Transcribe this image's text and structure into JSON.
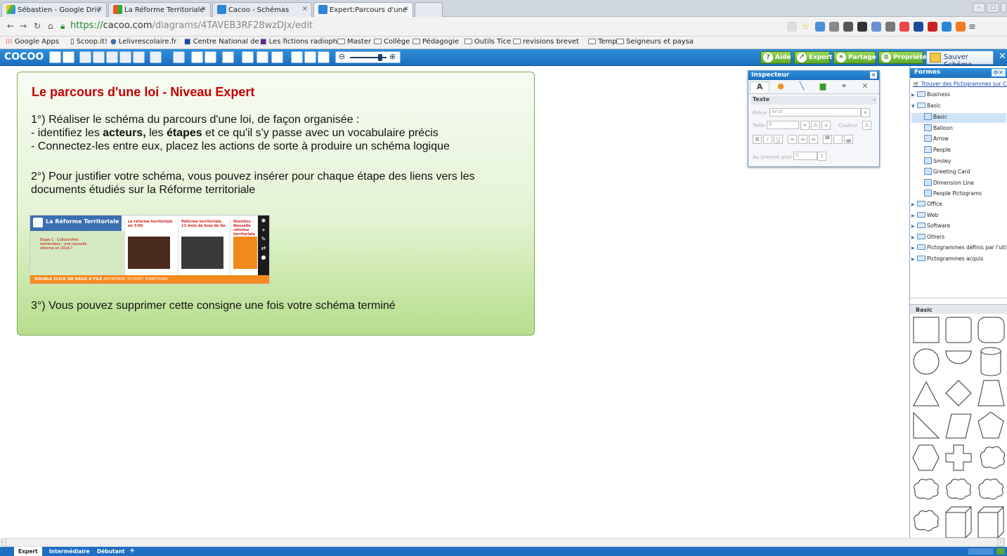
{
  "browser": {
    "tabs": [
      {
        "title": "Sébastien - Google Driv"
      },
      {
        "title": "La Réforme Territoriale"
      },
      {
        "title": "Cacoo - Schémas"
      },
      {
        "title": "Expert:Parcours d'une"
      }
    ],
    "url_scheme": "https://",
    "url_host": "cacoo.com",
    "url_path": "/diagrams/4TAVEB3RF28wzDJx/edit"
  },
  "bookmarks": [
    "Google Apps",
    "Scoop.it!",
    "Lelivrescolaire.fr",
    "Centre National de",
    "Les fictions radioph",
    "Master",
    "Collège",
    "Pédagogie",
    "Outils Tice",
    "revisions brevet",
    "Temp",
    "Seigneurs et paysa"
  ],
  "app": {
    "logo": "COCOO",
    "aide": "Aide",
    "export": "Export",
    "partage": "Partage",
    "proprietes": "Propriétés",
    "sauver": "Sauver Schéma"
  },
  "diagram": {
    "title": "Le parcours d'une loi - Niveau Expert",
    "p1_line1": "1°) Réaliser le schéma du parcours d'une loi, de façon organisée :",
    "p1_line2_a": "- identifiez les ",
    "p1_line2_b": "acteurs,",
    "p1_line2_c": " les ",
    "p1_line2_d": "étapes",
    "p1_line2_e": " et ce qu'il s'y passe avec un vocabulaire précis",
    "p1_line3": "- Connectez-les entre eux, placez les actions de sorte à produire un schéma logique",
    "p2_line1": "2°) Pour justifier votre schéma, vous pouvez insérer pour chaque étape des liens vers les",
    "p2_line2": "documents étudiés sur la Réforme territoriale",
    "p3": "3°) Vous pouvez supprimer cette consigne une fois votre schéma terminé",
    "embed": {
      "header": "La Réforme Territoriale",
      "footer_bold": "DOUBLE CLICK OR DRAG A FILE",
      "footer_rest": " ANYWHERE TO POST SOMETHING",
      "card1": "La réforme territoriale en 3:00",
      "card2": "Réforme territoriale, 11 mois de bras de fer",
      "card3": "Désintox - Nouvelle réforme territoriale française",
      "step": "Etape 1 : Collectivités territoriales - une nouvelle réforme en 2014 ?"
    }
  },
  "inspector": {
    "title": "Inspecteur",
    "section": "Texte",
    "police_label": "Police",
    "police_value": "Arial",
    "taille_label": "Taille",
    "taille_value": "8",
    "couleur_label": "Couleur",
    "premier_plan_label": "Au premier plan",
    "premier_plan_value": "0"
  },
  "formes": {
    "title": "Formes",
    "link": "Trouver des Pictogrammes sur Ca",
    "tree": [
      {
        "label": "Business",
        "kind": "folder",
        "level": 0
      },
      {
        "label": "Basic",
        "kind": "folder-open",
        "level": 0
      },
      {
        "label": "Basic",
        "kind": "pic",
        "level": 1,
        "selected": true
      },
      {
        "label": "Balloon",
        "kind": "pic",
        "level": 1
      },
      {
        "label": "Arrow",
        "kind": "pic",
        "level": 1
      },
      {
        "label": "People",
        "kind": "pic",
        "level": 1
      },
      {
        "label": "Smiley",
        "kind": "pic",
        "level": 1
      },
      {
        "label": "Greeting Card",
        "kind": "pic",
        "level": 1
      },
      {
        "label": "Dimension Line",
        "kind": "pic",
        "level": 1
      },
      {
        "label": "People Pictograms",
        "kind": "pic",
        "level": 1
      },
      {
        "label": "Office",
        "kind": "folder",
        "level": 0
      },
      {
        "label": "Web",
        "kind": "folder",
        "level": 0
      },
      {
        "label": "Software",
        "kind": "folder",
        "level": 0
      },
      {
        "label": "Others",
        "kind": "folder",
        "level": 0
      },
      {
        "label": "Pictogrammes définis par l'utilisa",
        "kind": "folder",
        "level": 0
      },
      {
        "label": "Pictogrammes acquis",
        "kind": "folder",
        "level": 0
      }
    ],
    "basic_header": "Basic"
  },
  "pages": {
    "tabs": [
      "Expert",
      "Intermédiaire",
      "Débutant"
    ],
    "add": "+"
  }
}
